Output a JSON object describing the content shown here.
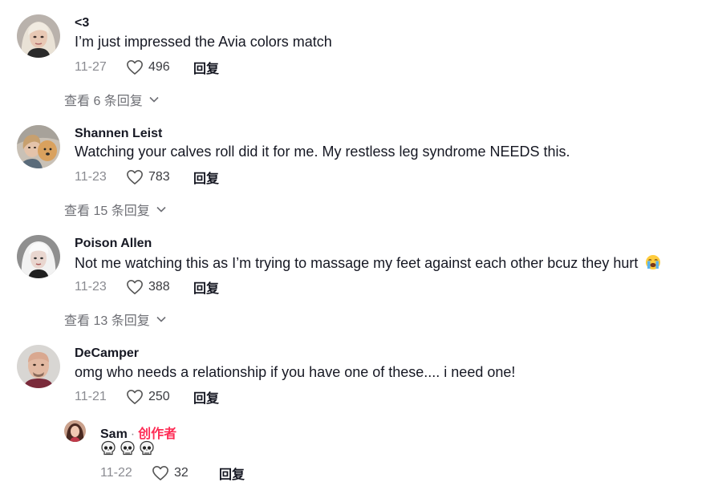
{
  "comments": [
    {
      "author": "<3",
      "text": "I’m just impressed the Avia colors match",
      "date": "11-27",
      "likes": "496",
      "reply_label": "回复",
      "view_replies": "查看 6 条回复",
      "avatar_icon": "avatar-blonde-woman"
    },
    {
      "author": "Shannen Leist",
      "text": "Watching your calves roll did it for me. My restless leg syndrome NEEDS this.",
      "date": "11-23",
      "likes": "783",
      "reply_label": "回复",
      "view_replies": "查看 15 条回复",
      "avatar_icon": "avatar-woman-with-dog"
    },
    {
      "author": "Poison Allen",
      "text": "Not me watching this as I’m trying to massage my feet against each other bcuz they hurt",
      "emoji": "loudly-crying-face-icon",
      "date": "11-23",
      "likes": "388",
      "reply_label": "回复",
      "view_replies": "查看 13 条回复",
      "avatar_icon": "avatar-white-hair"
    },
    {
      "author": "DeCamper",
      "text": "omg who needs a relationship if you have one of these.... i need one!",
      "date": "11-21",
      "likes": "250",
      "reply_label": "回复",
      "avatar_icon": "avatar-bald-man",
      "reply": {
        "author": "Sam",
        "separator": "·",
        "creator_label": "创作者",
        "text_icons": [
          "skull-icon",
          "skull-icon",
          "skull-icon"
        ],
        "date": "11-22",
        "likes": "32",
        "reply_label": "回复",
        "avatar_icon": "avatar-dark-hair-woman"
      }
    }
  ],
  "colors": {
    "creator": "#fe2c55",
    "date": "#8a8b91",
    "text": "#161823"
  }
}
